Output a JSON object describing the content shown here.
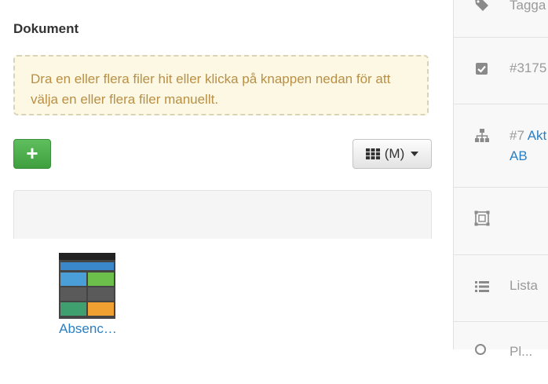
{
  "documents": {
    "title": "Dokument",
    "dropzone_text": "Dra en eller flera filer hit eller klicka på knappen nedan för att välja en eller flera filer manuellt.",
    "add_button_label": "+",
    "view_button_label": "(M)",
    "files": [
      {
        "name": "Absenc…",
        "icon": "file-thumbnail"
      }
    ]
  },
  "sidebar": {
    "rows": [
      {
        "icon": "tags-icon",
        "text": "Tagga"
      },
      {
        "icon": "checkbox-icon",
        "text": "#3175"
      },
      {
        "icon": "sitemap-icon",
        "prefix": "#7",
        "link": "Akt",
        "link2": "AB"
      },
      {
        "icon": "object-group-icon",
        "text": ""
      },
      {
        "icon": "list-icon",
        "text": "Lista"
      },
      {
        "icon": "search-icon",
        "text": "Pl..."
      }
    ]
  },
  "colors": {
    "accent": "#2a7fc4",
    "success": "#4cae4c",
    "warning_bg": "#fcf8e3",
    "warning_text": "#b98f45"
  }
}
